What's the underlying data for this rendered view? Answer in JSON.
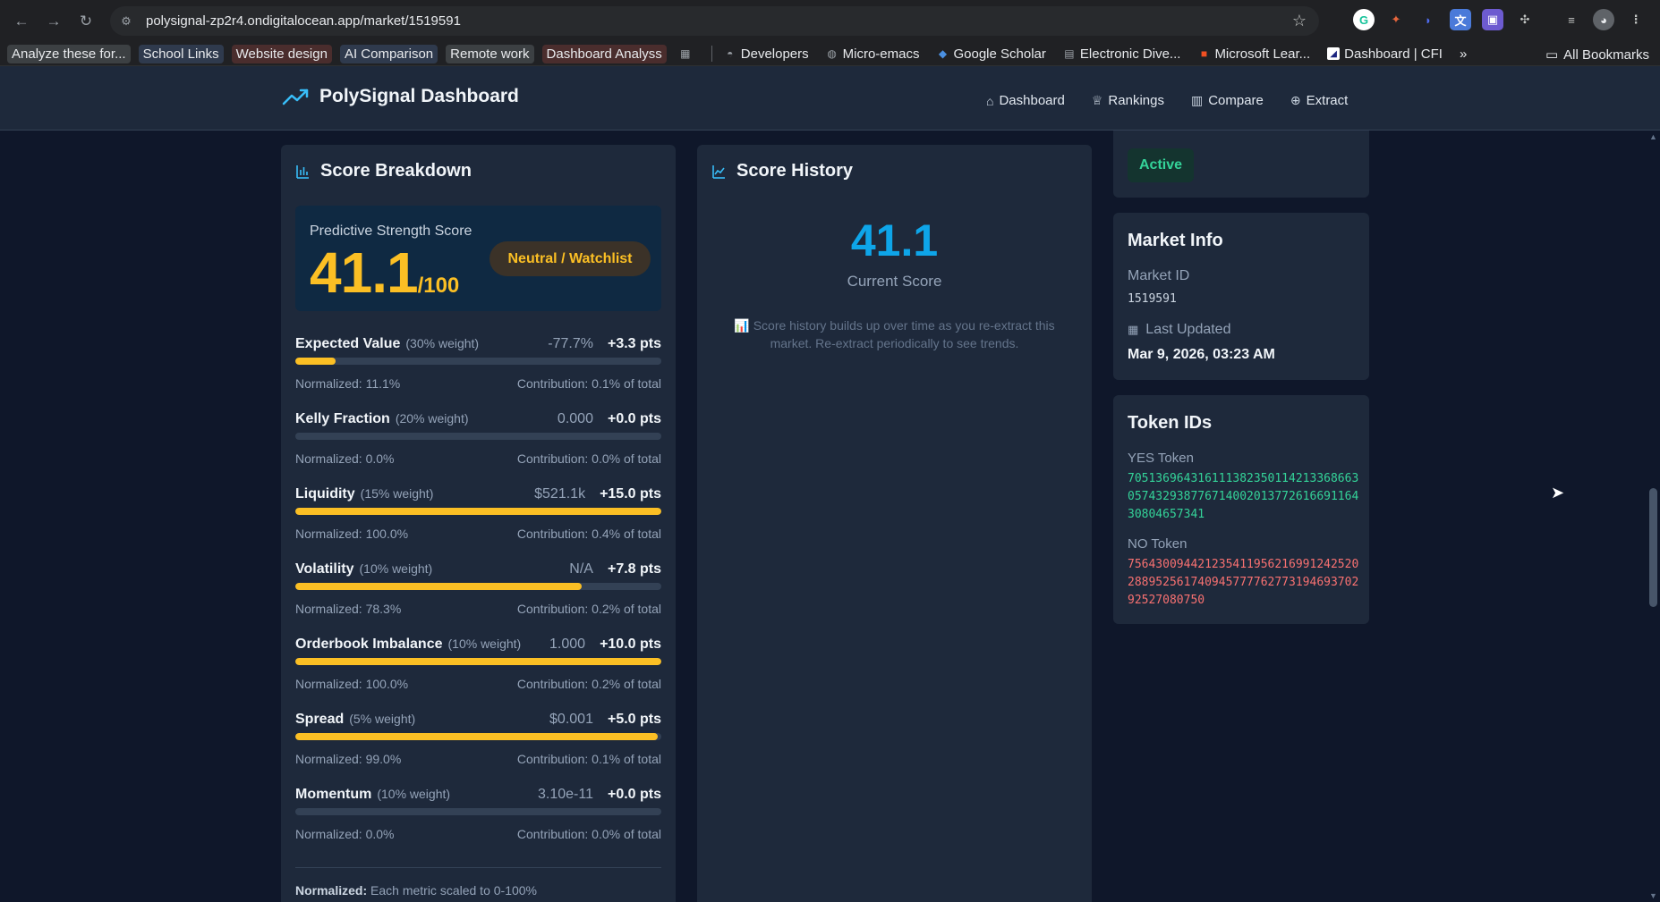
{
  "browser": {
    "url": "polysignal-zp2r4.ondigitalocean.app/market/1519591",
    "bookmarks": [
      {
        "label": "Analyze these for...",
        "style": "pill"
      },
      {
        "label": "School Links",
        "style": "pill-blue"
      },
      {
        "label": "Website design",
        "style": "pill-red"
      },
      {
        "label": "AI Comparison",
        "style": "pill-blue"
      },
      {
        "label": "Remote work",
        "style": "pill"
      },
      {
        "label": "Dashboard Analyss",
        "style": "pill-red"
      }
    ],
    "bookmarks_icons": [
      {
        "label": "Developers",
        "icon": "developers-icon"
      },
      {
        "label": "Micro-emacs",
        "icon": "globe-icon"
      },
      {
        "label": "Google Scholar",
        "icon": "scholar-icon"
      },
      {
        "label": "Electronic Dive...",
        "icon": "doc-icon"
      },
      {
        "label": "Microsoft Lear...",
        "icon": "microsoft-icon"
      },
      {
        "label": "Dashboard | CFI",
        "icon": "cfi-icon"
      }
    ],
    "all_bookmarks": "All Bookmarks"
  },
  "app": {
    "brand": "PolySignal Dashboard",
    "nav": [
      {
        "label": "Dashboard",
        "glyph": "⌂"
      },
      {
        "label": "Rankings",
        "glyph": "♕"
      },
      {
        "label": "Compare",
        "glyph": "▥"
      },
      {
        "label": "Extract",
        "glyph": "⊕"
      }
    ]
  },
  "breakdown": {
    "title": "Score Breakdown",
    "score_label": "Predictive Strength Score",
    "score": "41.1",
    "score_denom": "/100",
    "badge": "Neutral / Watchlist",
    "metrics": [
      {
        "name": "Expected Value",
        "weight": "(30% weight)",
        "value": "-77.7%",
        "pts": "+3.3 pts",
        "normalized": "Normalized: 11.1%",
        "contribution": "Contribution: 0.1% of total",
        "fill": 0.111
      },
      {
        "name": "Kelly Fraction",
        "weight": "(20% weight)",
        "value": "0.000",
        "pts": "+0.0 pts",
        "normalized": "Normalized: 0.0%",
        "contribution": "Contribution: 0.0% of total",
        "fill": 0.0
      },
      {
        "name": "Liquidity",
        "weight": "(15% weight)",
        "value": "$521.1k",
        "pts": "+15.0 pts",
        "normalized": "Normalized: 100.0%",
        "contribution": "Contribution: 0.4% of total",
        "fill": 1.0
      },
      {
        "name": "Volatility",
        "weight": "(10% weight)",
        "value": "N/A",
        "pts": "+7.8 pts",
        "normalized": "Normalized: 78.3%",
        "contribution": "Contribution: 0.2% of total",
        "fill": 0.783
      },
      {
        "name": "Orderbook Imbalance",
        "weight": "(10% weight)",
        "value": "1.000",
        "pts": "+10.0 pts",
        "normalized": "Normalized: 100.0%",
        "contribution": "Contribution: 0.2% of total",
        "fill": 1.0
      },
      {
        "name": "Spread",
        "weight": "(5% weight)",
        "value": "$0.001",
        "pts": "+5.0 pts",
        "normalized": "Normalized: 99.0%",
        "contribution": "Contribution: 0.1% of total",
        "fill": 0.99
      },
      {
        "name": "Momentum",
        "weight": "(10% weight)",
        "value": "3.10e-11",
        "pts": "+0.0 pts",
        "normalized": "Normalized: 0.0%",
        "contribution": "Contribution: 0.0% of total",
        "fill": 0.0
      }
    ],
    "footer_bold": "Normalized:",
    "footer_text": "Each metric scaled to 0-100%"
  },
  "history": {
    "title": "Score History",
    "current_score": "41.1",
    "current_label": "Current Score",
    "note": "📊 Score history builds up over time as you re-extract this market. Re-extract periodically to see trends."
  },
  "status": {
    "label": "Active"
  },
  "market_info": {
    "title": "Market Info",
    "id_label": "Market ID",
    "id_value": "1519591",
    "updated_label": "Last Updated",
    "updated_value": "Mar 9, 2026, 03:23 AM"
  },
  "tokens": {
    "title": "Token IDs",
    "yes_label": "YES Token",
    "yes_value": "70513696431611138235011421336866305743293877671400201377261669116430804657341",
    "no_label": "NO Token",
    "no_value": "75643009442123541195621699124252028895256174094577776277319469370292527080750"
  },
  "colors": {
    "accent": "#38bdf8",
    "score": "#fbbf24",
    "active": "#34d399",
    "no_token": "#f87171"
  }
}
